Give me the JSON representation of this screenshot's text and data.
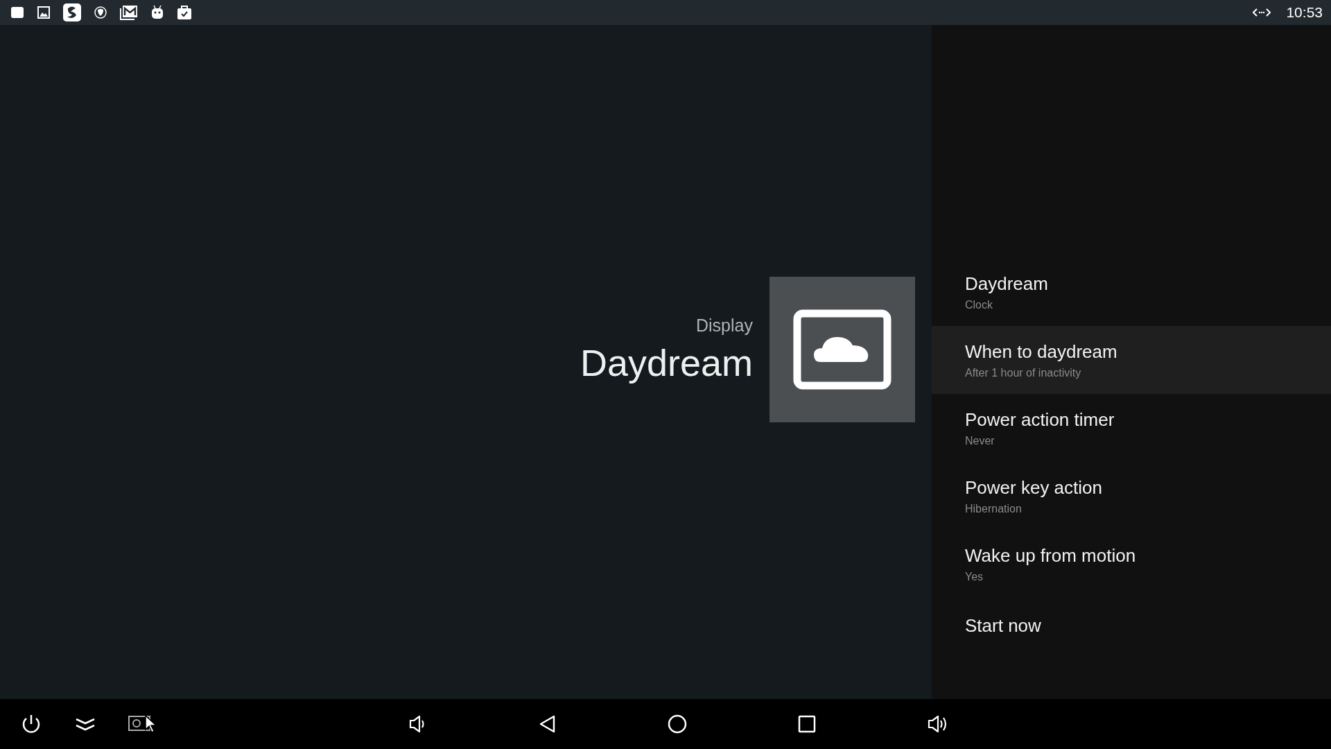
{
  "status_bar": {
    "time": "10:53"
  },
  "header": {
    "breadcrumb": "Display",
    "title": "Daydream"
  },
  "settings": [
    {
      "title": "Daydream",
      "subtitle": "Clock",
      "selected": false
    },
    {
      "title": "When to daydream",
      "subtitle": "After 1 hour of inactivity",
      "selected": true
    },
    {
      "title": "Power action timer",
      "subtitle": "Never",
      "selected": false
    },
    {
      "title": "Power key action",
      "subtitle": "Hibernation",
      "selected": false
    },
    {
      "title": "Wake up from motion",
      "subtitle": "Yes",
      "selected": false
    },
    {
      "title": "Start now",
      "selected": false
    }
  ]
}
